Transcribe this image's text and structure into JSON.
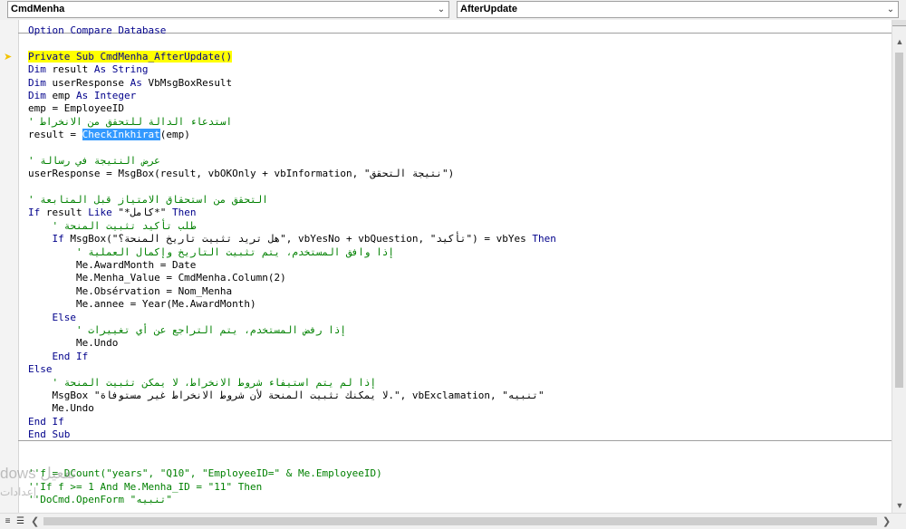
{
  "object_combo": {
    "value": "CmdMenha"
  },
  "procedure_combo": {
    "value": "AfterUpdate"
  },
  "icons": {
    "dropdown": "chevron-down-icon",
    "exec_pointer": "execution-arrow-icon",
    "scroll_up": "arrow-up-icon",
    "scroll_down": "arrow-down-icon",
    "scroll_left": "arrow-left-icon",
    "scroll_right": "arrow-right-icon",
    "procedure_view": "procedure-view-icon",
    "module_view": "full-module-view-icon"
  },
  "colors": {
    "keyword": "#00008b",
    "comment": "#008000",
    "exec_highlight": "#ffff00",
    "selection": "#3399ff"
  },
  "code": {
    "l0": "Option Compare Database",
    "l1_kw": "Private Sub CmdMenha_AfterUpdate()",
    "l2_kw": "Dim",
    "l2": " result ",
    "l2b_kw": "As String",
    "l3_kw": "Dim",
    "l3": " userResponse ",
    "l3b_kw": "As",
    "l3c": " VbMsgBoxResult",
    "l4_kw": "Dim",
    "l4": " emp ",
    "l4b_kw": "As Integer",
    "l5": "emp = EmployeeID",
    "l6_cm": "' استدعاء الدالة للتحقق من الانخراط",
    "l7a": "result = ",
    "l7_sel": "CheckInkhirat",
    "l7b": "(emp)",
    "l8_cm": "' عرض النتيجة في رسالة",
    "l9": "userResponse = MsgBox(result, vbOKOnly + vbInformation, \"نتيجة التحقق\")",
    "l10_cm": "' التحقق من استحقاق الامتياز قبل المتابعة",
    "l11_kw": "If",
    "l11": " result ",
    "l11b_kw": "Like",
    "l11c": " \"*كامل*\" ",
    "l11d_kw": "Then",
    "l12_cm": "    ' طلب تأكيد تثبيت المنحة",
    "l13a": "    ",
    "l13_kw": "If",
    "l13": " MsgBox(\"هل تريد تثبيت تاريخ المنحة؟\", vbYesNo + vbQuestion, \"تأكيد\") = vbYes ",
    "l13b_kw": "Then",
    "l14_cm": "        ' إذا وافق المستخدم، يتم تثبيت التاريخ وإكمال العملية",
    "l15": "        Me.AwardMonth = Date",
    "l16": "        Me.Menha_Value = CmdMenha.Column(2)",
    "l17": "        Me.Obsérvation = Nom_Menha",
    "l18": "        Me.annee = Year(Me.AwardMonth)",
    "l19_kw": "    Else",
    "l20_cm": "        ' إذا رفض المستخدم، يتم التراجع عن أي تغييرات",
    "l21": "        Me.Undo",
    "l22_kw": "    End If",
    "l23_kw": "Else",
    "l24_cm": "    ' إذا لم يتم استيفاء شروط الانخراط، لا يمكن تثبيت المنحة",
    "l25": "    MsgBox \"لا يمكنك تثبيت المنحة لأن شروط الانخراط غير مستوفاة.\", vbExclamation, \"تنبيه\"",
    "l26": "    Me.Undo",
    "l27_kw": "End If",
    "l28_kw": "End Sub",
    "l29_cm": "''f = DCount(\"years\", \"Q10\", \"EmployeeID=\" & Me.EmployeeID)",
    "l30_cm": "''If f >= 1 And Me.Menha_ID = \"11\" Then",
    "l31_cm": "''DoCmd.OpenForm \"تنبيه\""
  },
  "watermark": {
    "line1": "dows ﺗﻔﻌﻴﻞ",
    "line2": "إعدادات"
  }
}
